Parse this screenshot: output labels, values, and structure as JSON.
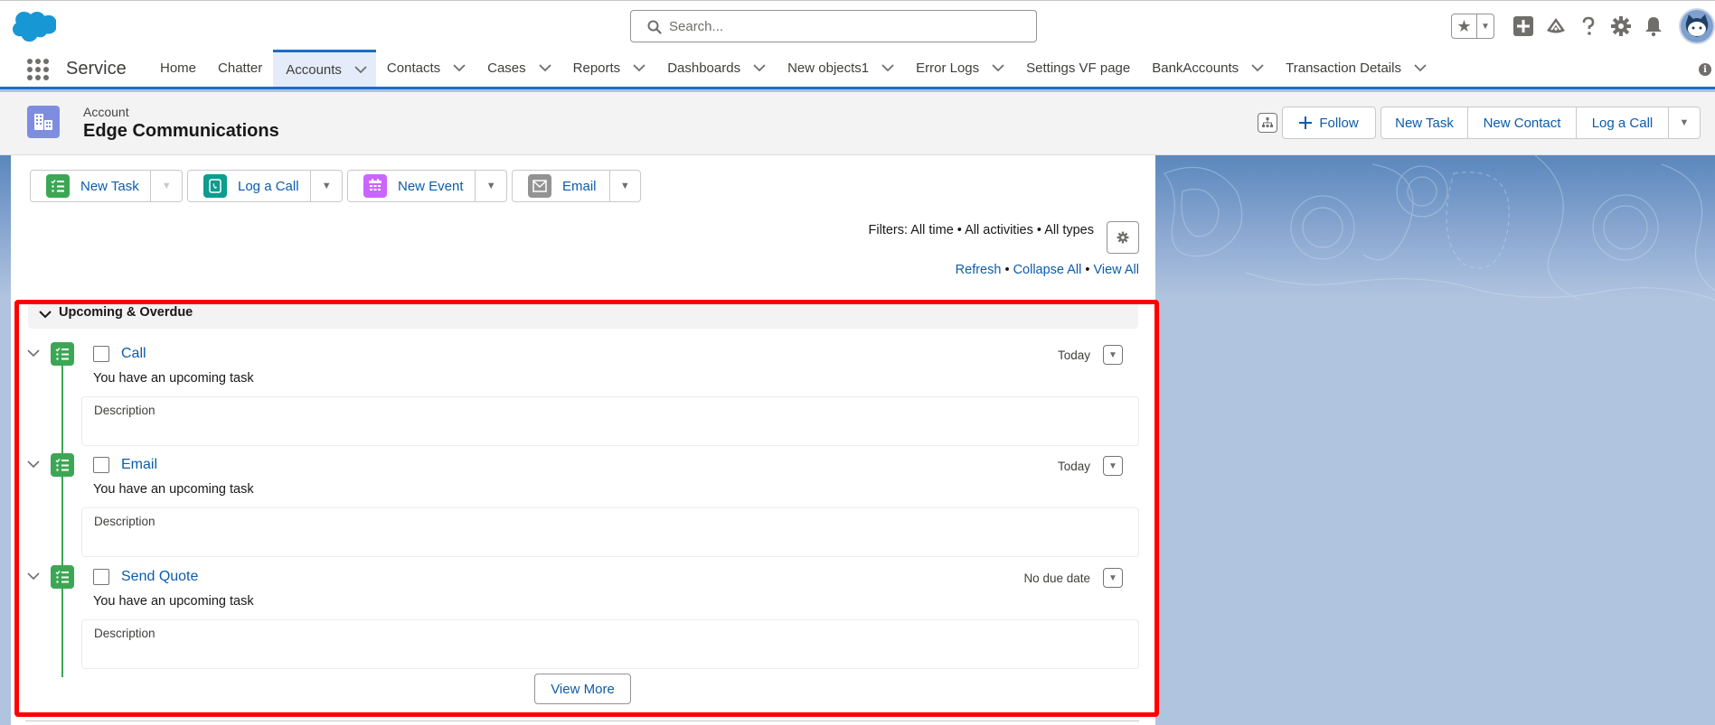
{
  "header": {
    "search_placeholder": "Search...",
    "icons": [
      "salesforce-cloud-logo",
      "favorites-star-icon",
      "favorites-caret-icon",
      "global-actions-plus-icon",
      "trailhead-icon",
      "help-icon",
      "setup-gear-icon",
      "notifications-bell-icon",
      "user-avatar"
    ]
  },
  "nav": {
    "app_name": "Service",
    "tabs": [
      {
        "label": "Home",
        "has_menu": false,
        "active": false
      },
      {
        "label": "Chatter",
        "has_menu": false,
        "active": false
      },
      {
        "label": "Accounts",
        "has_menu": true,
        "active": true
      },
      {
        "label": "Contacts",
        "has_menu": true,
        "active": false
      },
      {
        "label": "Cases",
        "has_menu": true,
        "active": false
      },
      {
        "label": "Reports",
        "has_menu": true,
        "active": false
      },
      {
        "label": "Dashboards",
        "has_menu": true,
        "active": false
      },
      {
        "label": "New objects1",
        "has_menu": true,
        "active": false
      },
      {
        "label": "Error Logs",
        "has_menu": true,
        "active": false
      },
      {
        "label": "Settings VF page",
        "has_menu": false,
        "active": false
      },
      {
        "label": "BankAccounts",
        "has_menu": true,
        "active": false
      },
      {
        "label": "Transaction Details",
        "has_menu": true,
        "active": false
      }
    ]
  },
  "record": {
    "type": "Account",
    "title": "Edge Communications",
    "follow_label": "Follow",
    "actions": [
      "New Task",
      "New Contact",
      "Log a Call"
    ]
  },
  "activity": {
    "buttons": [
      {
        "label": "New Task",
        "icon": "task-icon",
        "color": "#3ba755",
        "dropdown_disabled": true
      },
      {
        "label": "Log a Call",
        "icon": "log-call-icon",
        "color": "#0c9d8e",
        "dropdown_disabled": false
      },
      {
        "label": "New Event",
        "icon": "event-calendar-icon",
        "color": "#cb65ff",
        "dropdown_disabled": false
      },
      {
        "label": "Email",
        "icon": "email-icon",
        "color": "#939393",
        "dropdown_disabled": false
      }
    ],
    "filters_text": "Filters: All time • All activities • All types",
    "links": {
      "refresh": "Refresh",
      "collapse_all": "Collapse All",
      "view_all": "View All",
      "separator": " • "
    },
    "section_title": "Upcoming & Overdue",
    "items": [
      {
        "subject": "Call",
        "date": "Today",
        "message": "You have an upcoming task",
        "description_label": "Description"
      },
      {
        "subject": "Email",
        "date": "Today",
        "message": "You have an upcoming task",
        "description_label": "Description"
      },
      {
        "subject": "Send Quote",
        "date": "No due date",
        "message": "You have an upcoming task",
        "description_label": "Description"
      }
    ],
    "view_more_label": "View More"
  },
  "colors": {
    "brand_blue": "#1b6ec2",
    "link_blue": "#0b5cab",
    "task_green": "#3ba755",
    "account_purple": "#7f8de1",
    "highlight_red": "#ff0000"
  }
}
